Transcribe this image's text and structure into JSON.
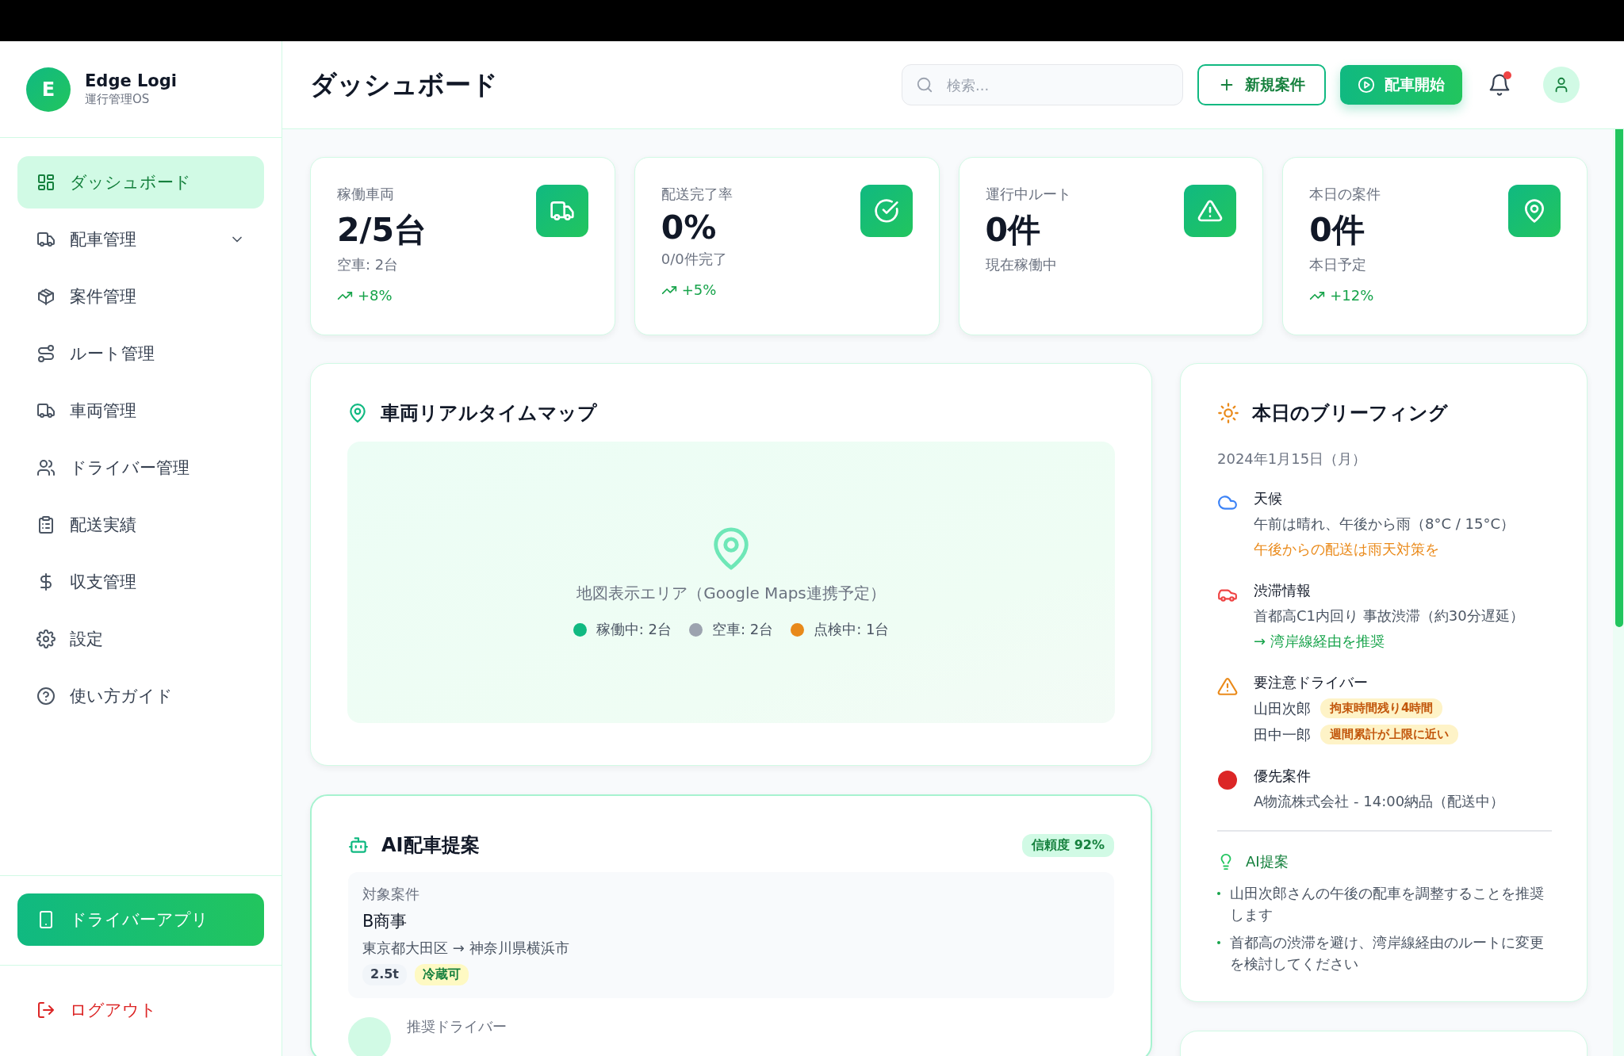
{
  "app": {
    "logo_letter": "E",
    "name": "Edge Logi",
    "subtitle": "運行管理OS"
  },
  "nav": [
    {
      "label": "ダッシュボード",
      "selected": true,
      "kind": "link"
    },
    {
      "label": "配車管理",
      "selected": false,
      "kind": "group"
    },
    {
      "label": "案件管理",
      "selected": false,
      "kind": "link"
    },
    {
      "label": "ルート管理",
      "selected": false,
      "kind": "link"
    },
    {
      "label": "車両管理",
      "selected": false,
      "kind": "link"
    },
    {
      "label": "ドライバー管理",
      "selected": false,
      "kind": "link"
    },
    {
      "label": "配送実績",
      "selected": false,
      "kind": "link"
    },
    {
      "label": "収支管理",
      "selected": false,
      "kind": "link"
    },
    {
      "label": "設定",
      "selected": false,
      "kind": "link"
    },
    {
      "label": "使い方ガイド",
      "selected": false,
      "kind": "link"
    }
  ],
  "driver_app_button": "ドライバーアプリ",
  "logout": "ログアウト",
  "header": {
    "title": "ダッシュボード",
    "search": {
      "placeholder": "検索..."
    },
    "new_button": "新規案件",
    "dispatch_button": "配車開始",
    "notifications": {
      "unread": true
    }
  },
  "stats": [
    {
      "label": "稼働車両",
      "value": "2/5台",
      "sub": "空車: 2台",
      "trend": "+8%"
    },
    {
      "label": "配送完了率",
      "value": "0%",
      "sub": "0/0件完了",
      "trend": "+5%"
    },
    {
      "label": "運行中ルート",
      "value": "0件",
      "sub": "現在稼働中"
    },
    {
      "label": "本日の案件",
      "value": "0件",
      "sub": "本日予定",
      "trend": "+12%"
    }
  ],
  "map": {
    "title": "車両リアルタイムマップ",
    "placeholder": "地図表示エリア（Google Maps連携予定）",
    "legend": [
      {
        "label": "稼働中: 2台",
        "color": "#10b981"
      },
      {
        "label": "空車: 2台",
        "color": "#9ca3af"
      },
      {
        "label": "点検中: 1台",
        "color": "#e8891a"
      }
    ]
  },
  "ai_dispatch": {
    "title": "AI配車提案",
    "confidence": "信頼度 92%",
    "target": {
      "label": "対象案件",
      "name": "B商事",
      "route": "東京都大田区 → 神奈川県横浜市",
      "tags": [
        {
          "text": "2.5t",
          "kind": "plain"
        },
        {
          "text": "冷蔵可",
          "kind": "highlight"
        }
      ]
    },
    "driver_label": "推奨ドライバー"
  },
  "briefing": {
    "title": "本日のブリーフィング",
    "date": "2024年1月15日（月）",
    "sections": [
      {
        "title": "天候",
        "lines": [
          {
            "text": "午前は晴れ、午後から雨（8°C / 15°C）",
            "kind": "plain"
          },
          {
            "text": "午後からの配送は雨天対策を",
            "kind": "warning"
          }
        ]
      },
      {
        "title": "渋滞情報",
        "lines": [
          {
            "text": "首都高C1内回り 事故渋滞（約30分遅延）",
            "kind": "plain"
          },
          {
            "text": "→ 湾岸線経由を推奨",
            "kind": "advice"
          }
        ]
      },
      {
        "title": "要注意ドライバー",
        "drivers": [
          {
            "name": "山田次郎",
            "note": "拘束時間残り4時間"
          },
          {
            "name": "田中一郎",
            "note": "週間累計が上限に近い"
          }
        ]
      },
      {
        "title": "優先案件",
        "lines": [
          {
            "text": "A物流株式会社 - 14:00納品（配送中）",
            "kind": "plain"
          }
        ]
      }
    ],
    "ai": {
      "title": "AI提案",
      "items": [
        "山田次郎さんの午後の配車を調整することを推奨します",
        "首都高の渋滞を避け、湾岸線経由のルートに変更を検討してください"
      ]
    }
  }
}
